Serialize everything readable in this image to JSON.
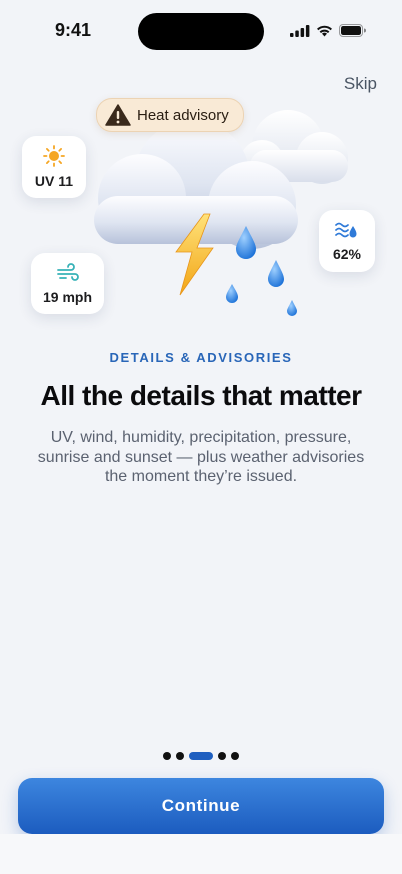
{
  "status_bar": {
    "time": "9:41"
  },
  "header": {
    "skip_label": "Skip"
  },
  "hero": {
    "advisory_label": "Heat advisory",
    "uv_label": "UV 11",
    "wind_label": "19 mph",
    "humidity_label": "62%",
    "icons": [
      "sun-icon",
      "wind-icon",
      "humidity-icon",
      "warning-icon",
      "lightning-icon",
      "cloud-icon"
    ]
  },
  "content": {
    "eyebrow": "DETAILS & ADVISORIES",
    "title": "All the details that matter",
    "body": "UV, wind, humidity, precipitation, pressure, sunrise and sunset — plus weather advisories the moment they’re issued."
  },
  "pager": {
    "total": 5,
    "current": 3
  },
  "cta": {
    "label": "Continue"
  },
  "colors": {
    "accent": "#1f5fc0",
    "eyebrow": "#2966b8",
    "background": "#f2f4f8"
  }
}
